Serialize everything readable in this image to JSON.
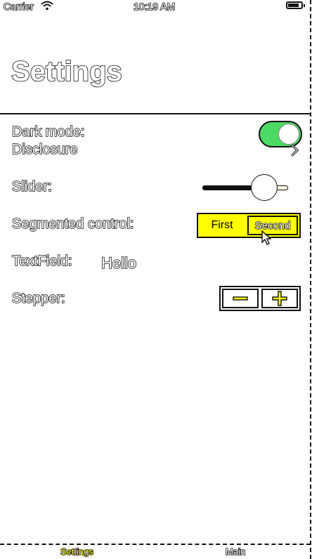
{
  "status_bar": {
    "carrier": "Carrier",
    "time": "10:19 AM",
    "icons": [
      "wifi-icon",
      "battery-icon"
    ]
  },
  "page": {
    "title": "Settings"
  },
  "rows": {
    "dark_mode": {
      "label": "Dark mode:",
      "toggle_on": true
    },
    "disclosure": {
      "label": "Disclosure",
      "icon": "chevron-right-icon"
    },
    "slider": {
      "label": "Slider:",
      "value": 0.72
    },
    "segmented": {
      "label": "Segmented control:",
      "options": [
        "First",
        "Second"
      ],
      "selected": "Second"
    },
    "text_field": {
      "label": "TextField:",
      "value": "Hello"
    },
    "stepper": {
      "label": "Stepper:",
      "minus": "−",
      "plus": "+"
    }
  },
  "tab_bar": {
    "tabs": [
      {
        "label": "Settings",
        "active": true
      },
      {
        "label": "Main",
        "active": false
      }
    ]
  },
  "colors": {
    "toggle_on": "#4cd964",
    "segment_fill": "#ffff00",
    "active_tab": "#ffff00"
  }
}
